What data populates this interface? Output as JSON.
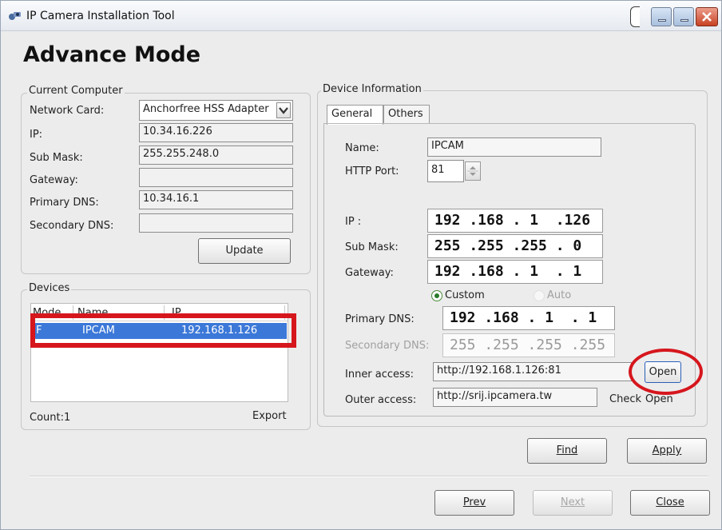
{
  "window": {
    "title": "IP Camera Installation Tool"
  },
  "heading": "Advance Mode",
  "current_computer": {
    "group_label": "Current Computer",
    "network_card_label": "Network Card:",
    "network_card_value": "Anchorfree HSS Adapter",
    "ip_label": "IP:",
    "ip_value": "10.34.16.226",
    "submask_label": "Sub Mask:",
    "submask_value": "255.255.248.0",
    "gateway_label": "Gateway:",
    "gateway_value": "",
    "primary_dns_label": "Primary DNS:",
    "primary_dns_value": "10.34.16.1",
    "secondary_dns_label": "Secondary DNS:",
    "secondary_dns_value": "",
    "update_label": "Update"
  },
  "devices": {
    "group_label": "Devices",
    "columns": [
      "Mode",
      "Name",
      "IP"
    ],
    "rows": [
      {
        "mode": "F",
        "name": "IPCAM",
        "ip": "192.168.1.126"
      }
    ],
    "count_label": "Count:1",
    "export_label": "Export"
  },
  "device_info": {
    "group_label": "Device Information",
    "tabs": [
      {
        "label": "General"
      },
      {
        "label": "Others"
      }
    ],
    "name_label": "Name:",
    "name_value": "IPCAM",
    "http_port_label": "HTTP Port:",
    "http_port_value": "81",
    "ip_label": "IP :",
    "ip_value": "192 .168 . 1  .126",
    "submask_label": "Sub Mask:",
    "submask_value": "255 .255 .255 . 0",
    "gateway_label": "Gateway:",
    "gateway_value": "192 .168 . 1  . 1",
    "custom_label": "Custom",
    "auto_label": "Auto",
    "primary_dns_label": "Primary DNS:",
    "primary_dns_value": "192 .168 . 1  . 1",
    "secondary_dns_label": "Secondary DNS:",
    "secondary_dns_value": "255 .255 .255 .255",
    "inner_access_label": "Inner access:",
    "inner_access_value": "http://192.168.1.126:81",
    "open_label": "Open",
    "outer_access_label": "Outer access:",
    "outer_access_value": "http://srij.ipcamera.tw",
    "check_label": "Check",
    "open2_label": "Open"
  },
  "buttons": {
    "find": "Find",
    "apply": "Apply",
    "prev": "Prev",
    "next": "Next",
    "close": "Close"
  },
  "colors": {
    "highlight": "#d6161d",
    "selection": "#3b78d8"
  }
}
